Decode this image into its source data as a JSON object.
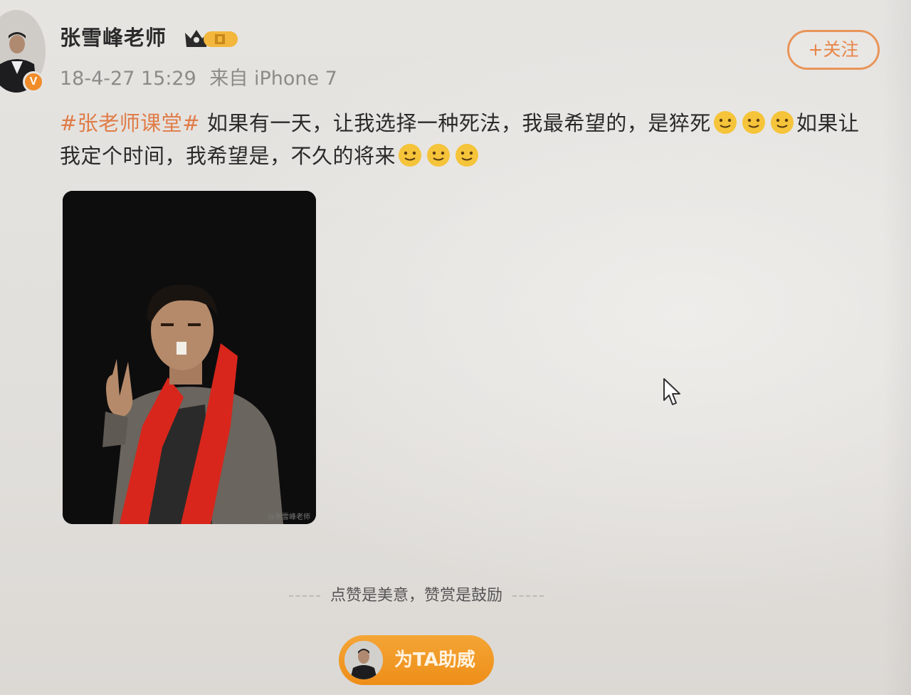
{
  "post": {
    "author": "张雪峰老师",
    "verified_badge": "V",
    "timestamp": "18-4-27 15:29",
    "source": "来自 iPhone 7",
    "follow_label": "+关注",
    "hashtag": "#张老师课堂#",
    "text_part1": "如果有一天，让我选择一种死法，我最希望的，是猝死",
    "text_part2": "如果让我定个时间，我希望是，不久的将来",
    "emoji_name": "smile-emoji",
    "image_watermark": "@张雪峰老师"
  },
  "reward": {
    "tip": "点赞是美意，赞赏是鼓励",
    "button_label": "为TA助威"
  },
  "colors": {
    "hashtag": "#e07c48",
    "follow_border": "#e8955a",
    "cheer_button": "#f39a24",
    "verified": "#f08c2a",
    "scarf": "#d8261c"
  }
}
